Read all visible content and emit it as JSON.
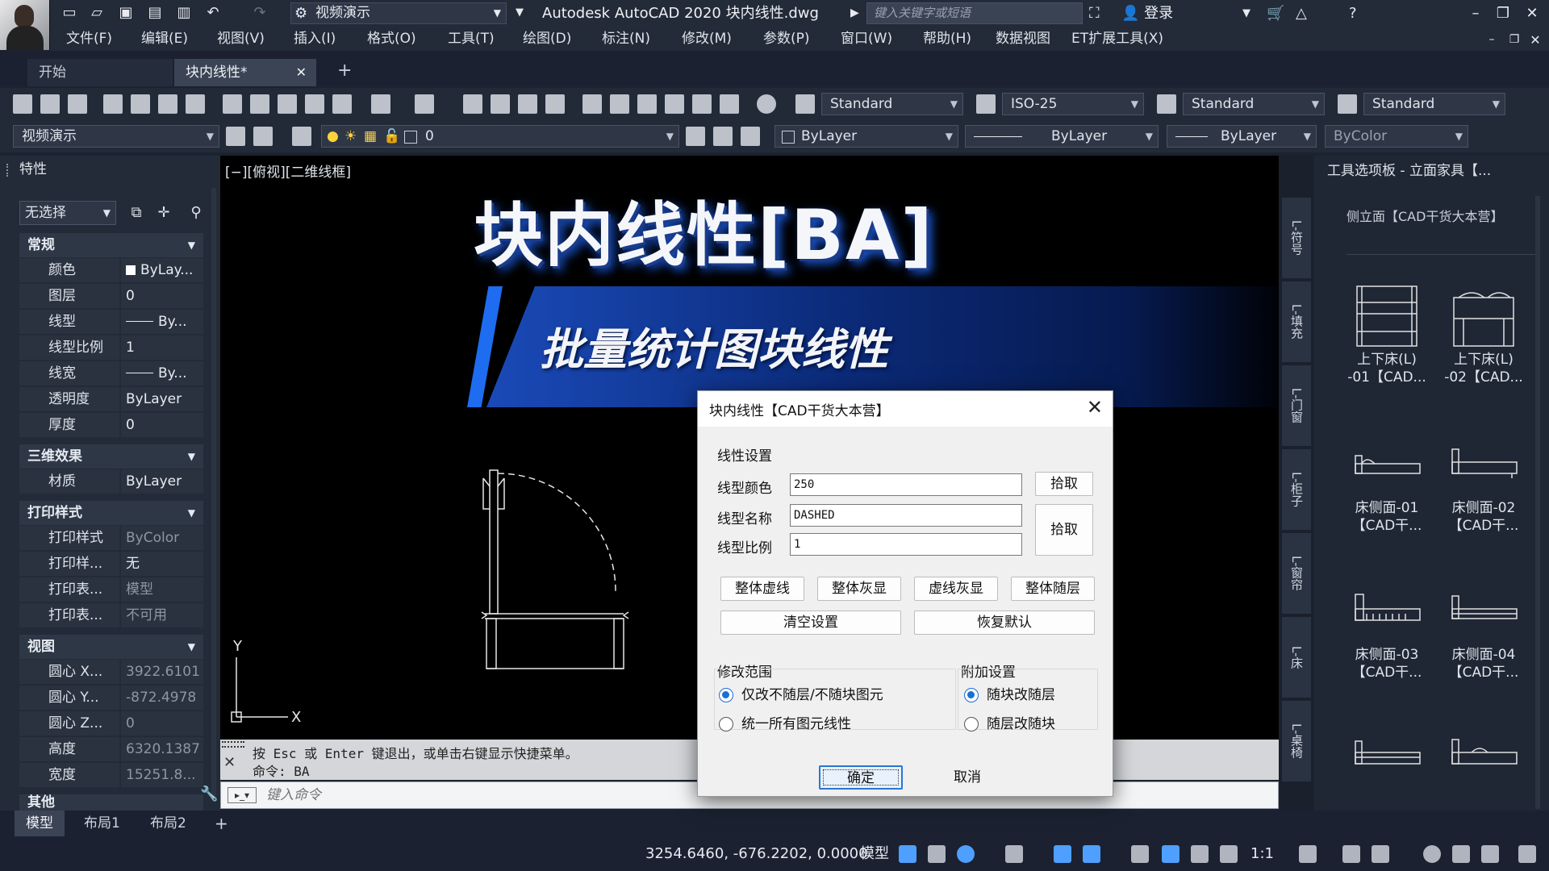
{
  "titlebar": {
    "workspace": "视频演示",
    "app_title": "Autodesk AutoCAD 2020    块内线性.dwg",
    "search_placeholder": "键入关键字或短语",
    "login": "登录"
  },
  "menu": [
    "文件(F)",
    "编辑(E)",
    "视图(V)",
    "插入(I)",
    "格式(O)",
    "工具(T)",
    "绘图(D)",
    "标注(N)",
    "修改(M)",
    "参数(P)",
    "窗口(W)",
    "帮助(H)",
    "数据视图",
    "ET扩展工具(X)"
  ],
  "doc_tabs": {
    "start": "开始",
    "current": "块内线性*"
  },
  "toolbar": {
    "text_style": "Standard",
    "dim_style": "ISO-25",
    "table_style": "Standard",
    "mleader_style": "Standard",
    "layer_state": "视频演示",
    "layer": "0",
    "color": "ByLayer",
    "linetype": "ByLayer",
    "lineweight": "ByLayer",
    "plot_style": "ByColor"
  },
  "properties": {
    "title": "特性",
    "selection": "无选择",
    "sections": {
      "general": "常规",
      "threed": "三维效果",
      "plot": "打印样式",
      "view": "视图",
      "misc": "其他"
    },
    "general": [
      {
        "k": "颜色",
        "v": "ByLay..."
      },
      {
        "k": "图层",
        "v": "0"
      },
      {
        "k": "线型",
        "v": "By..."
      },
      {
        "k": "线型比例",
        "v": "1"
      },
      {
        "k": "线宽",
        "v": "By..."
      },
      {
        "k": "透明度",
        "v": "ByLayer"
      },
      {
        "k": "厚度",
        "v": "0"
      }
    ],
    "threed": [
      {
        "k": "材质",
        "v": "ByLayer"
      }
    ],
    "plot": [
      {
        "k": "打印样式",
        "v": "ByColor"
      },
      {
        "k": "打印样...",
        "v": "无"
      },
      {
        "k": "打印表...",
        "v": "模型"
      },
      {
        "k": "打印表...",
        "v": "不可用"
      }
    ],
    "view": [
      {
        "k": "圆心 X...",
        "v": "3922.6101"
      },
      {
        "k": "圆心 Y...",
        "v": "-872.4978"
      },
      {
        "k": "圆心 Z...",
        "v": "0"
      },
      {
        "k": "高度",
        "v": "6320.1387"
      },
      {
        "k": "宽度",
        "v": "15251.8..."
      }
    ]
  },
  "canvas": {
    "viewport_label": "[−][俯视][二维线框]",
    "banner_title": "块内线性[BA]",
    "banner_subtitle": "批量统计图块线性",
    "ucs_y": "Y",
    "ucs_x": "X"
  },
  "command": {
    "line1": "按 Esc 或 Enter 键退出，或单击右键显示快捷菜单。",
    "line2": "命令: BA",
    "placeholder": "键入命令"
  },
  "palette": {
    "title": "工具选项板 - 立面家具【...",
    "subtitle": "侧立面【CAD干货大本营】",
    "tabs": [
      "L-符号",
      "L-填充",
      "L-门窗",
      "L-柜子",
      "L-窗帘",
      "L-床",
      "L-桌椅"
    ],
    "items": [
      {
        "l1": "上下床(L)",
        "l2": "-01【CAD..."
      },
      {
        "l1": "上下床(L)",
        "l2": "-02【CAD..."
      },
      {
        "l1": "床侧面-01",
        "l2": "【CAD干..."
      },
      {
        "l1": "床侧面-02",
        "l2": "【CAD干..."
      },
      {
        "l1": "床侧面-03",
        "l2": "【CAD干..."
      },
      {
        "l1": "床侧面-04",
        "l2": "【CAD干..."
      },
      {
        "l1": "",
        "l2": ""
      },
      {
        "l1": "",
        "l2": ""
      }
    ]
  },
  "layout_tabs": [
    "模型",
    "布局1",
    "布局2"
  ],
  "status": {
    "coords": "3254.6460, -676.2202, 0.0000",
    "model": "模型",
    "scale": "1:1"
  },
  "dialog": {
    "title": "块内线性【CAD干货大本营】",
    "group_linetype": "线性设置",
    "color_label": "线型颜色",
    "color_value": "250",
    "name_label": "线型名称",
    "name_value": "DASHED",
    "scale_label": "线型比例",
    "scale_value": "1",
    "pick": "拾取",
    "pick2": "拾取",
    "btn_all_dash": "整体虚线",
    "btn_all_gray": "整体灰显",
    "btn_dash_gray": "虚线灰显",
    "btn_all_bylayer": "整体随层",
    "btn_clear": "清空设置",
    "btn_restore": "恢复默认",
    "group_scope": "修改范围",
    "scope_opt1": "仅改不随层/不随块图元",
    "scope_opt2": "统一所有图元线性",
    "group_extra": "附加设置",
    "extra_opt1": "随块改随层",
    "extra_opt2": "随层改随块",
    "ok": "确定",
    "cancel": "取消"
  }
}
